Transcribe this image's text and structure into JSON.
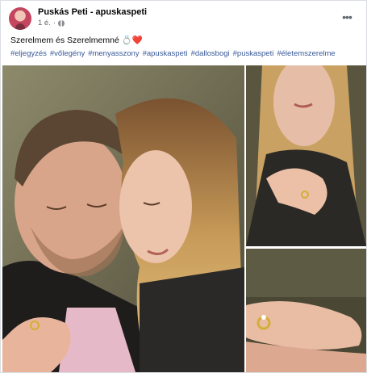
{
  "post": {
    "author": "Puskás Peti - apuskaspeti",
    "time": "1 é.",
    "text": "Szerelmem és Szerelmemné",
    "text_emoji": "💍❤️",
    "hashtags": [
      "#eljegyzés",
      "#vőlegény",
      "#menyasszony",
      "#apuskaspeti",
      "#dallosbogi",
      "#puskaspeti",
      "#életemszerelme"
    ],
    "more_icon": "more-horizontal-icon",
    "privacy_icon": "globe-icon"
  },
  "colors": {
    "hashtag": "#385898",
    "heart": "#e41e3f",
    "meta": "#65676b"
  }
}
